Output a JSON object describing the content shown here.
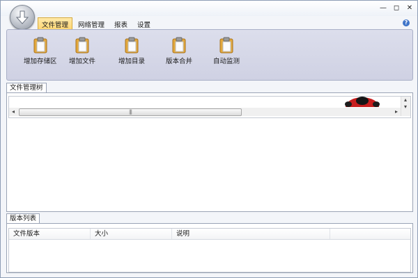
{
  "window": {
    "controls": [
      "minimize-icon",
      "maximize-icon",
      "close-icon"
    ],
    "glyphs": {
      "minimize": "—",
      "maximize": "◻",
      "close": "✕"
    }
  },
  "tabs": [
    {
      "label": "文件管理",
      "active": true
    },
    {
      "label": "网络管理",
      "active": false
    },
    {
      "label": "报表",
      "active": false
    },
    {
      "label": "设置",
      "active": false
    }
  ],
  "help": {
    "icon": "help-icon",
    "glyph": "?"
  },
  "ribbon": {
    "buttons": [
      {
        "label": "增加存储区",
        "icon": "clipboard-icon"
      },
      {
        "label": "增加文件",
        "icon": "clipboard-icon"
      },
      {
        "label": "增加目录",
        "icon": "clipboard-icon"
      },
      {
        "label": "版本合并",
        "icon": "clipboard-icon"
      },
      {
        "label": "自动监测",
        "icon": "clipboard-icon"
      }
    ]
  },
  "tree_panel": {
    "tab_label": "文件管理树"
  },
  "version_panel": {
    "tab_label": "版本列表",
    "columns": [
      "文件版本",
      "大小",
      "说明"
    ]
  },
  "colors": {
    "accent_tab": "#ffd36b",
    "ribbon": "#d6d8ea",
    "border": "#9aa3b5"
  }
}
